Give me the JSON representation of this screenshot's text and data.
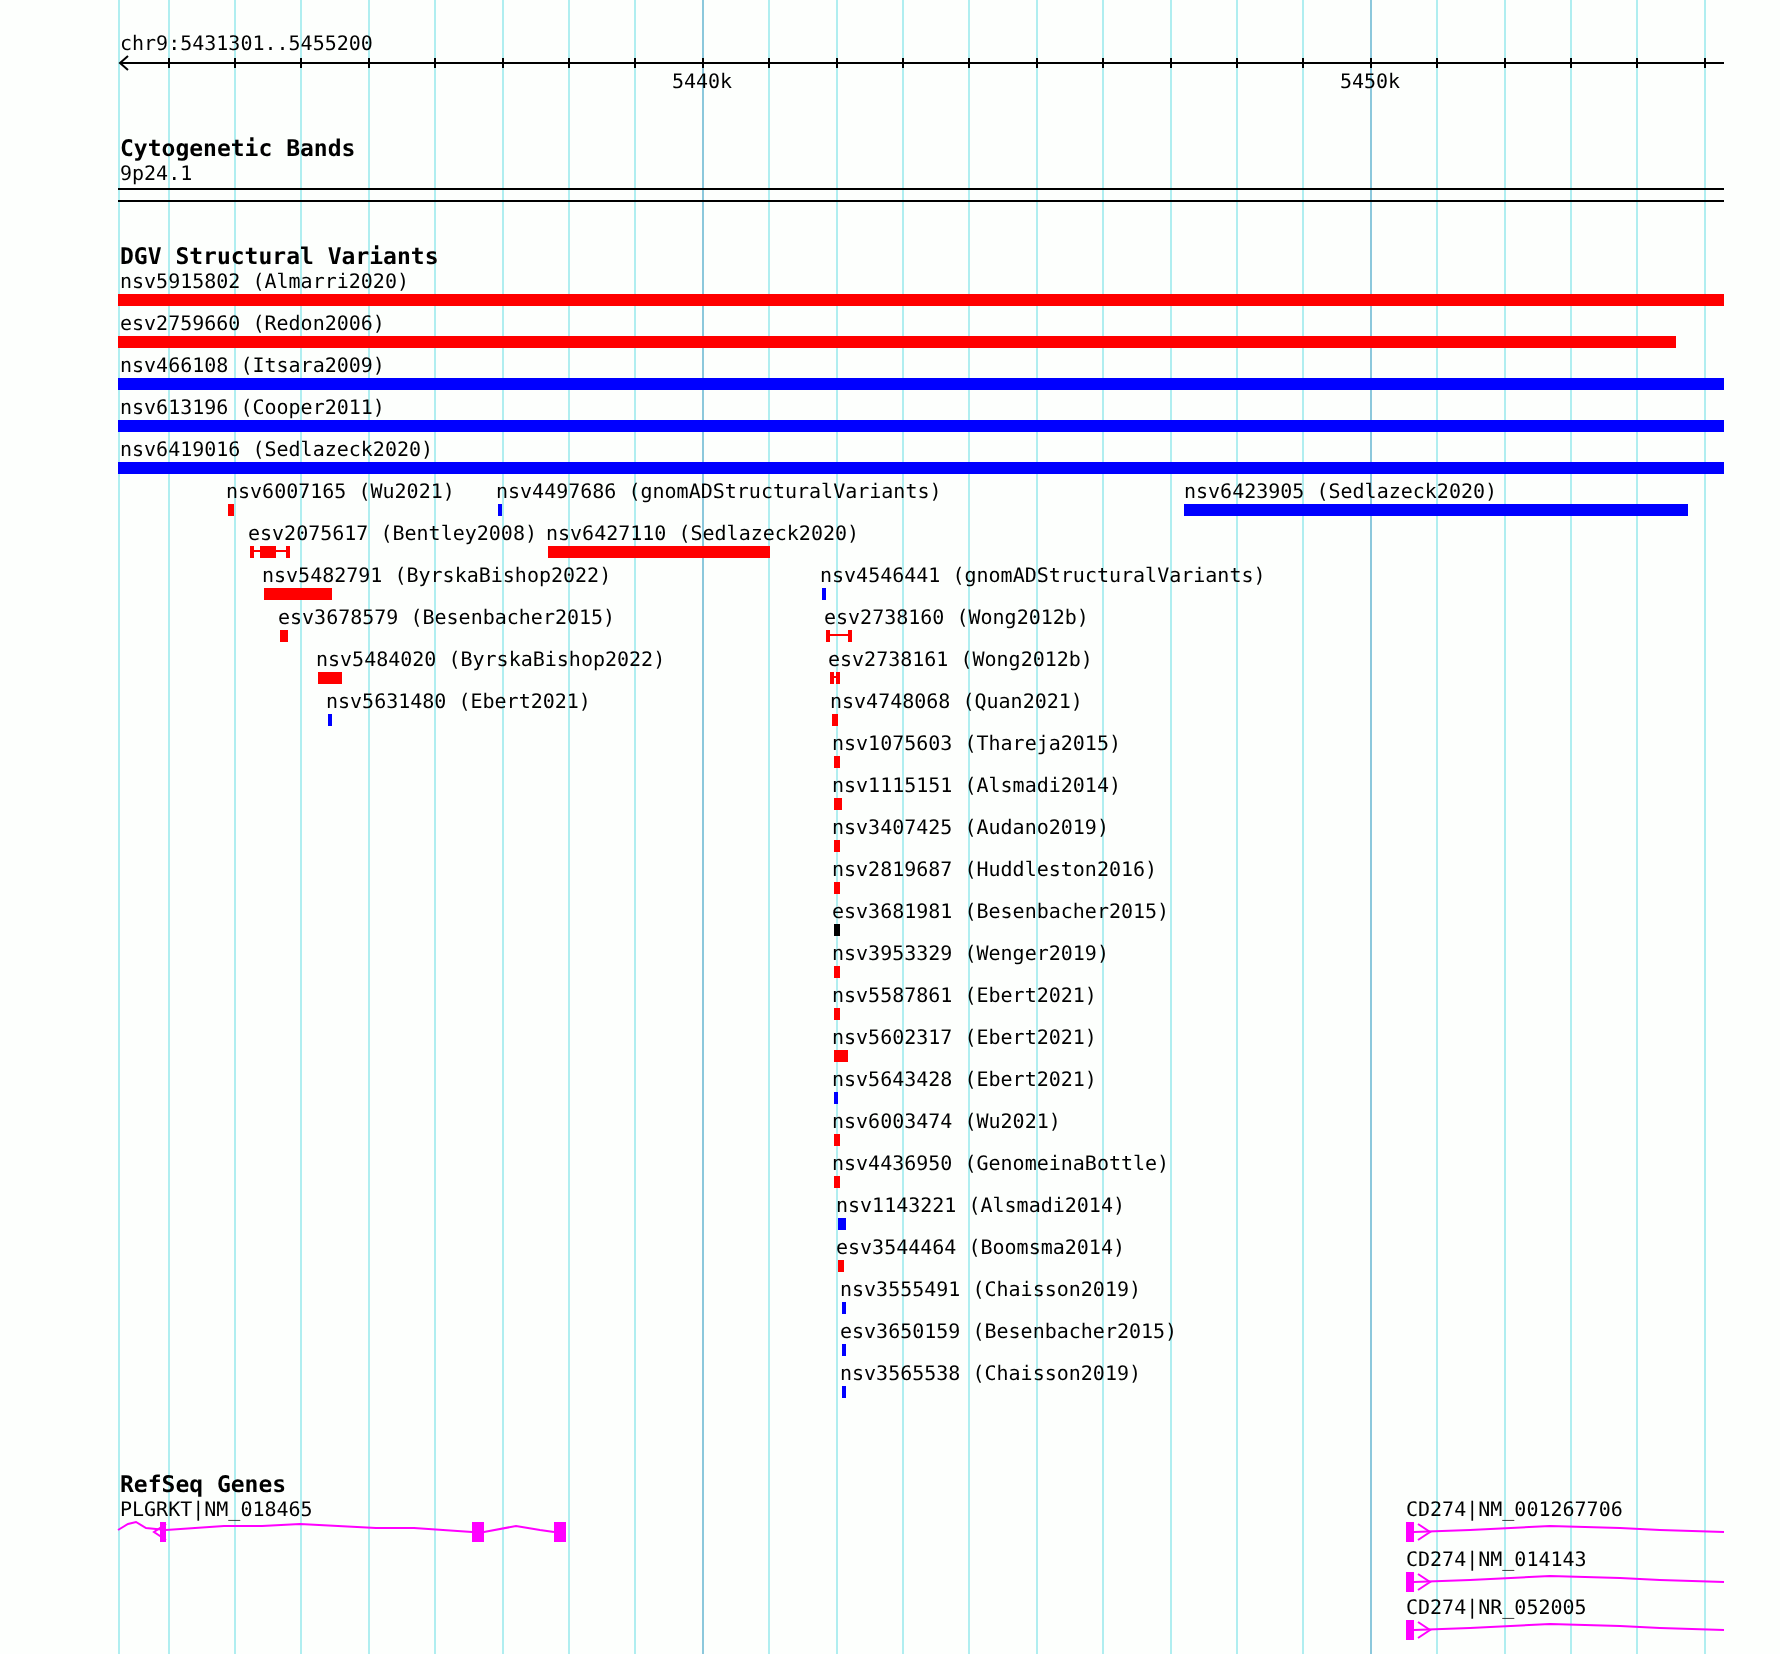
{
  "location": "chr9:5431301..5455200",
  "ruler": {
    "tick_labels": [
      "5440k",
      "5450k"
    ]
  },
  "tracks": [
    {
      "kind": "bands",
      "title": "Cytogenetic Bands",
      "features": [
        {
          "label": "9p24.1"
        }
      ]
    },
    {
      "kind": "variants",
      "title": "DGV Structural Variants",
      "features": [
        {
          "label": "nsv5915802 (Almarri2020)",
          "color": "#ff0000",
          "kind": "bar"
        },
        {
          "label": "esv2759660 (Redon2006)",
          "color": "#ff0000",
          "kind": "bar"
        },
        {
          "label": "nsv466108 (Itsara2009)",
          "color": "#0000ff",
          "kind": "bar"
        },
        {
          "label": "nsv613196 (Cooper2011)",
          "color": "#0000ff",
          "kind": "bar"
        },
        {
          "label": "nsv6419016 (Sedlazeck2020)",
          "color": "#0000ff",
          "kind": "bar"
        },
        {
          "label": "nsv6007165 (Wu2021)",
          "color": "#ff0000",
          "kind": "bar"
        },
        {
          "label": "nsv4497686 (gnomADStructuralVariants)",
          "color": "#0000ff",
          "kind": "bar"
        },
        {
          "label": "nsv6423905 (Sedlazeck2020)",
          "color": "#0000ff",
          "kind": "bar"
        },
        {
          "label": "esv2075617 (Bentley2008)",
          "color": "#ff0000",
          "kind": "capped"
        },
        {
          "label": "nsv6427110 (Sedlazeck2020)",
          "color": "#ff0000",
          "kind": "bar"
        },
        {
          "label": "nsv5482791 (ByrskaBishop2022)",
          "color": "#ff0000",
          "kind": "bar"
        },
        {
          "label": "nsv4546441 (gnomADStructuralVariants)",
          "color": "#0000ff",
          "kind": "bar"
        },
        {
          "label": "esv3678579 (Besenbacher2015)",
          "color": "#ff0000",
          "kind": "bar"
        },
        {
          "label": "esv2738160 (Wong2012b)",
          "color": "#ff0000",
          "kind": "capped"
        },
        {
          "label": "nsv5484020 (ByrskaBishop2022)",
          "color": "#ff0000",
          "kind": "bar"
        },
        {
          "label": "esv2738161 (Wong2012b)",
          "color": "#ff0000",
          "kind": "capped"
        },
        {
          "label": "nsv5631480 (Ebert2021)",
          "color": "#0000ff",
          "kind": "bar"
        },
        {
          "label": "nsv4748068 (Quan2021)",
          "color": "#ff0000",
          "kind": "bar"
        },
        {
          "label": "nsv1075603 (Thareja2015)",
          "color": "#ff0000",
          "kind": "bar"
        },
        {
          "label": "nsv1115151 (Alsmadi2014)",
          "color": "#ff0000",
          "kind": "bar"
        },
        {
          "label": "nsv3407425 (Audano2019)",
          "color": "#ff0000",
          "kind": "bar"
        },
        {
          "label": "nsv2819687 (Huddleston2016)",
          "color": "#ff0000",
          "kind": "bar"
        },
        {
          "label": "esv3681981 (Besenbacher2015)",
          "color": "#000000",
          "kind": "bar"
        },
        {
          "label": "nsv3953329 (Wenger2019)",
          "color": "#ff0000",
          "kind": "bar"
        },
        {
          "label": "nsv5587861 (Ebert2021)",
          "color": "#ff0000",
          "kind": "bar"
        },
        {
          "label": "nsv5602317 (Ebert2021)",
          "color": "#ff0000",
          "kind": "bar"
        },
        {
          "label": "nsv5643428 (Ebert2021)",
          "color": "#0000ff",
          "kind": "bar"
        },
        {
          "label": "nsv6003474 (Wu2021)",
          "color": "#ff0000",
          "kind": "bar"
        },
        {
          "label": "nsv4436950 (GenomeinaBottle)",
          "color": "#ff0000",
          "kind": "bar"
        },
        {
          "label": "nsv1143221 (Alsmadi2014)",
          "color": "#0000ff",
          "kind": "bar"
        },
        {
          "label": "esv3544464 (Boomsma2014)",
          "color": "#ff0000",
          "kind": "bar"
        },
        {
          "label": "nsv3555491 (Chaisson2019)",
          "color": "#0000ff",
          "kind": "bar"
        },
        {
          "label": "esv3650159 (Besenbacher2015)",
          "color": "#0000ff",
          "kind": "bar"
        },
        {
          "label": "nsv3565538 (Chaisson2019)",
          "color": "#0000ff",
          "kind": "bar"
        }
      ]
    },
    {
      "kind": "genes",
      "title": "RefSeq Genes",
      "features": [
        {
          "label": "PLGRKT|NM_018465",
          "reverse": true
        },
        {
          "label": "CD274|NM_001267706",
          "reverse": false
        },
        {
          "label": "CD274|NM_014143",
          "reverse": false
        },
        {
          "label": "CD274|NR_052005",
          "reverse": false
        }
      ]
    }
  ]
}
